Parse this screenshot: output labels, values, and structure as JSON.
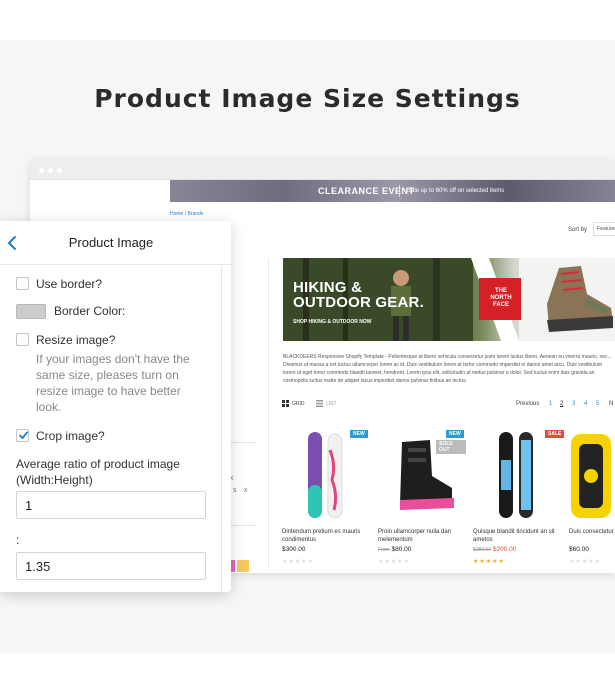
{
  "headline": "Product Image Size Settings",
  "store": {
    "banner": {
      "title": "CLEARANCE EVENT",
      "subtitle": "Sale up to 60% off on selected items"
    },
    "breadcrumb": "Home / Brands",
    "sort": {
      "label": "Sort by",
      "value": "Featured"
    },
    "sidebar_swatch_letters": [
      "X",
      "S",
      "X"
    ],
    "hero": {
      "title_line1": "HIKING &",
      "title_line2": "OUTDOOR GEAR.",
      "subtitle": "SHOP HIKING & OUTDOOR NOW",
      "brand_line1": "THE",
      "brand_line2": "NORTH",
      "brand_line3": "FACE"
    },
    "description": "BLACKDEERS Responsive Shopify Template - Pellentesque at libero vehicula consectetur justo lorem luctus libero. Aenean eu viverra mauris, nec... Divamus ut massa a est luctus ullamcorper lorem ac id. Duis vestibulum lorem at tortor commodo imperdiet in danos amet arcu. Duis vestibulum lorem ut eget tortor commodo blandit laoreet, hendrerit. Lorem ipsu elit, sollicitudin at metus pulvinar a dolor. Sed luctus enim duis gravida an cosmopolis luctus matte de aliquet iacus imperdiet danos pulvinar finibus an lectus.",
    "view": {
      "grid": "GRID",
      "list": "LIST"
    },
    "pager": {
      "previous": "Previous",
      "pages": [
        "1",
        "2",
        "3",
        "4",
        "5"
      ],
      "active": "2",
      "next": "N"
    },
    "products": [
      {
        "title": "Dintendum pretium es mauris condimentus",
        "price": "$300.00",
        "old_price": "",
        "prefix": "",
        "badge": "NEW",
        "badge2": "",
        "stars": "★★★★★",
        "rated": false
      },
      {
        "title": "Proin ullamcorper nulla dan melementum",
        "price": "$80.00",
        "old_price": "",
        "prefix": "From",
        "badge": "NEW",
        "badge2": "SOLD OUT",
        "stars": "★★★★★",
        "rated": false
      },
      {
        "title": "Quisque blandit tincidunt an sit ametos",
        "price": "$200.00",
        "old_price": "$280.00",
        "prefix": "",
        "badge": "SALE",
        "badge2": "",
        "stars": "★★★★★",
        "rated": true
      },
      {
        "title": "Duis consectetur mursus cosmo",
        "price": "$60.00",
        "old_price": "",
        "prefix": "",
        "badge": "",
        "badge2": "",
        "stars": "★★★★★",
        "rated": false
      }
    ]
  },
  "panel": {
    "title": "Product Image",
    "use_border": {
      "label": "Use border?",
      "checked": false
    },
    "border_color": {
      "label": "Border Color:",
      "value": "#cccccc"
    },
    "resize_image": {
      "label": "Resize image?",
      "checked": false
    },
    "resize_help": "If your images don't have the same size, pleases turn on resize image to have better look.",
    "crop_image": {
      "label": "Crop image?",
      "checked": true
    },
    "ratio_label": "Average ratio of product image (Width:Height)",
    "ratio_width": "1",
    "ratio_separator": ":",
    "ratio_height": "1.35"
  },
  "colors": {
    "accent": "#3b82c4",
    "sale": "#e74c3c",
    "brand_red": "#d42026"
  }
}
